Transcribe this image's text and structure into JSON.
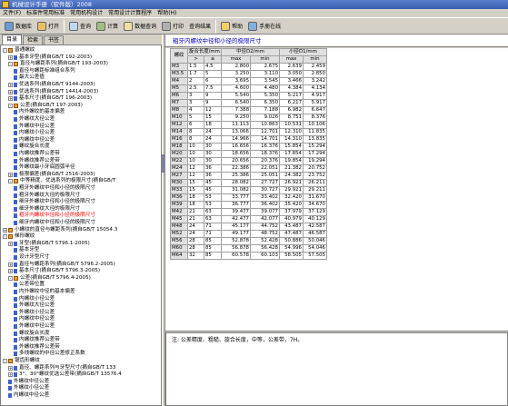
{
  "window": {
    "title": "机械设计手册（软件版）2008"
  },
  "menu": [
    "文件(F)",
    "标准件常用标准",
    "常用机构设计",
    "常用设计计算程序",
    "帮助(H)"
  ],
  "toolbar": {
    "items": [
      "数据库",
      "打开",
      "查询",
      "计算",
      "数据查询",
      "打印",
      "帮助",
      "手册在线"
    ],
    "status_text": "查询结果"
  },
  "tabs": [
    "目录",
    "检索",
    "书签"
  ],
  "tree": [
    {
      "label": "普通螺纹",
      "level": 1,
      "toggle": "-",
      "kind": "folder"
    },
    {
      "label": "基本牙型(摘自GB/T 192-2003)",
      "level": 2,
      "toggle": "+",
      "kind": "doc"
    },
    {
      "label": "直径与螺距系列(摘自GB/T 193-2003)",
      "level": 2,
      "toggle": "-",
      "kind": "folder"
    },
    {
      "label": "直径与螺距标准组合系列",
      "level": 3,
      "toggle": "",
      "kind": "doc"
    },
    {
      "label": "最大公差值",
      "level": 3,
      "toggle": "",
      "kind": "doc"
    },
    {
      "label": "优选系列(摘自GB/T 9144-2003)",
      "level": 2,
      "toggle": "+",
      "kind": "doc"
    },
    {
      "label": "优选系列(摘自GB/T 14414-2003)",
      "level": 2,
      "toggle": "+",
      "kind": "doc"
    },
    {
      "label": "基本尺寸(摘自GB/T 196-2003)",
      "level": 2,
      "toggle": "+",
      "kind": "doc"
    },
    {
      "label": "公差(摘自GB/T 197-2003)",
      "level": 2,
      "toggle": "-",
      "kind": "folder"
    },
    {
      "label": "内外螺纹的基本偏差",
      "level": 3,
      "toggle": "",
      "kind": "doc"
    },
    {
      "label": "外螺纹大径公差",
      "level": 3,
      "toggle": "",
      "kind": "doc"
    },
    {
      "label": "外螺纹中径公差",
      "level": 3,
      "toggle": "",
      "kind": "doc"
    },
    {
      "label": "内螺纹小径公差",
      "level": 3,
      "toggle": "",
      "kind": "doc"
    },
    {
      "label": "内螺纹中径公差",
      "level": 3,
      "toggle": "",
      "kind": "doc"
    },
    {
      "label": "螺纹旋合长度",
      "level": 3,
      "toggle": "",
      "kind": "doc"
    },
    {
      "label": "内螺纹推荐公差带",
      "level": 3,
      "toggle": "",
      "kind": "doc"
    },
    {
      "label": "外螺纹推荐公差带",
      "level": 3,
      "toggle": "",
      "kind": "doc"
    },
    {
      "label": "外螺纹最小牙底圆弧半径",
      "level": 3,
      "toggle": "",
      "kind": "doc"
    },
    {
      "label": "极限偏差(摘自GB/T 2516-2003)",
      "level": 2,
      "toggle": "+",
      "kind": "doc"
    },
    {
      "label": "中等精度、优选系列的极限尺寸(摘自GB/T",
      "level": 2,
      "toggle": "-",
      "kind": "folder"
    },
    {
      "label": "粗牙外螺纹中径和小径的极限尺寸",
      "level": 3,
      "toggle": "",
      "kind": "doc"
    },
    {
      "label": "粗牙外螺纹大径的极限尺寸",
      "level": 3,
      "toggle": "",
      "kind": "doc"
    },
    {
      "label": "细牙外螺纹中径和小径的极限尺寸",
      "level": 3,
      "toggle": "",
      "kind": "doc"
    },
    {
      "label": "细牙外螺纹大径的极限尺寸",
      "level": 3,
      "toggle": "",
      "kind": "doc"
    },
    {
      "label": "粗牙内螺纹中径和小径的极限尺寸",
      "level": 3,
      "toggle": "",
      "kind": "doc",
      "selected": true
    },
    {
      "label": "细牙内螺纹中径和小径的极限尺寸",
      "level": 3,
      "toggle": "",
      "kind": "doc"
    },
    {
      "label": "小螺纹的直径与螺距系列(摘自GB/T 15054.3",
      "level": 1,
      "toggle": "+",
      "kind": "folder"
    },
    {
      "label": "梯形螺纹",
      "level": 1,
      "toggle": "-",
      "kind": "folder"
    },
    {
      "label": "牙型(摘自GB/T 5796.1-2005)",
      "level": 2,
      "toggle": "+",
      "kind": "doc"
    },
    {
      "label": "基本牙型",
      "level": 3,
      "toggle": "",
      "kind": "doc"
    },
    {
      "label": "设计牙型尺寸",
      "level": 3,
      "toggle": "",
      "kind": "doc"
    },
    {
      "label": "直径与螺距系列(摘自GB/T 5796.2-2005)",
      "level": 2,
      "toggle": "+",
      "kind": "doc"
    },
    {
      "label": "基本尺寸(摘自GB/T 5796.3-2005)",
      "level": 2,
      "toggle": "+",
      "kind": "doc"
    },
    {
      "label": "公差(摘自GB/T 5796.4-2005)",
      "level": 2,
      "toggle": "-",
      "kind": "folder"
    },
    {
      "label": "公差带位置",
      "level": 3,
      "toggle": "",
      "kind": "doc"
    },
    {
      "label": "内外螺纹中径的基本偏差",
      "level": 3,
      "toggle": "",
      "kind": "doc"
    },
    {
      "label": "内螺纹小径公差",
      "level": 3,
      "toggle": "",
      "kind": "doc"
    },
    {
      "label": "外螺纹大径公差",
      "level": 3,
      "toggle": "",
      "kind": "doc"
    },
    {
      "label": "外螺纹小径公差",
      "level": 3,
      "toggle": "",
      "kind": "doc"
    },
    {
      "label": "内螺纹中径公差",
      "level": 3,
      "toggle": "",
      "kind": "doc"
    },
    {
      "label": "外螺纹中径公差",
      "level": 3,
      "toggle": "",
      "kind": "doc"
    },
    {
      "label": "螺纹旋合长度",
      "level": 3,
      "toggle": "",
      "kind": "doc"
    },
    {
      "label": "内螺纹推荐公差带",
      "level": 3,
      "toggle": "",
      "kind": "doc"
    },
    {
      "label": "外螺纹推荐公差带",
      "level": 3,
      "toggle": "",
      "kind": "doc"
    },
    {
      "label": "多线螺纹的中径公差修正系数",
      "level": 3,
      "toggle": "",
      "kind": "doc"
    },
    {
      "label": "锯齿形螺纹",
      "level": 1,
      "toggle": "-",
      "kind": "folder"
    },
    {
      "label": "直径、螺距系列与牙型尺寸(摘自GB/T 133",
      "level": 2,
      "toggle": "+",
      "kind": "doc"
    },
    {
      "label": "3°、30°螺纹优选公差带(摘自GB/T 13576.4",
      "level": 2,
      "toggle": "+",
      "kind": "doc"
    },
    {
      "label": "外螺纹中径公差",
      "level": 2,
      "toggle": "",
      "kind": "doc"
    },
    {
      "label": "外螺纹小径公差",
      "level": 2,
      "toggle": "",
      "kind": "doc"
    },
    {
      "label": "内螺纹中径公差",
      "level": 2,
      "toggle": "",
      "kind": "doc"
    }
  ],
  "panel": {
    "heading": "粗牙内螺纹中径和小径的极限尺寸"
  },
  "table": {
    "header1": [
      "螺纹",
      "旋合长度/mm",
      "中径D2/mm",
      "小径D1/mm"
    ],
    "header2": [
      ">",
      "≤",
      "max",
      "min",
      "max",
      "min"
    ],
    "rows": [
      [
        "M3",
        "1.5",
        "4.5",
        "2.800",
        "2.675",
        "2.639",
        "2.459"
      ],
      [
        "M3.5",
        "1.7",
        "5",
        "3.250",
        "3.110",
        "3.050",
        "2.850"
      ],
      [
        "M4",
        "2",
        "6",
        "3.695",
        "3.545",
        "3.466",
        "3.242"
      ],
      [
        "M5",
        "2.5",
        "7.5",
        "4.600",
        "4.480",
        "4.384",
        "4.134"
      ],
      [
        "M6",
        "3",
        "9",
        "5.540",
        "5.350",
        "5.217",
        "4.917"
      ],
      [
        "M7",
        "3",
        "9",
        "6.540",
        "6.350",
        "6.217",
        "5.917"
      ],
      [
        "M8",
        "4",
        "12",
        "7.388",
        "7.188",
        "6.982",
        "6.647"
      ],
      [
        "M10",
        "5",
        "15",
        "9.250",
        "9.026",
        "8.751",
        "8.376"
      ],
      [
        "M12",
        "6",
        "18",
        "11.113",
        "10.863",
        "10.531",
        "10.106"
      ],
      [
        "M14",
        "8",
        "24",
        "13.066",
        "12.701",
        "12.310",
        "11.835"
      ],
      [
        "M16",
        "8",
        "24",
        "14.966",
        "14.701",
        "14.310",
        "13.835"
      ],
      [
        "M18",
        "10",
        "30",
        "16.656",
        "16.376",
        "15.854",
        "15.294"
      ],
      [
        "M20",
        "10",
        "30",
        "18.656",
        "18.376",
        "17.854",
        "17.294"
      ],
      [
        "M22",
        "10",
        "30",
        "20.656",
        "20.376",
        "19.854",
        "19.294"
      ],
      [
        "M24",
        "12",
        "36",
        "22.386",
        "22.051",
        "21.382",
        "20.752"
      ],
      [
        "M27",
        "12",
        "36",
        "25.386",
        "25.051",
        "24.382",
        "23.752"
      ],
      [
        "M30",
        "15",
        "45",
        "28.082",
        "27.727",
        "26.921",
        "26.211"
      ],
      [
        "M33",
        "15",
        "45",
        "31.082",
        "30.727",
        "29.921",
        "29.211"
      ],
      [
        "M36",
        "18",
        "53",
        "33.777",
        "33.402",
        "32.420",
        "31.670"
      ],
      [
        "M39",
        "18",
        "53",
        "36.777",
        "36.402",
        "35.420",
        "34.670"
      ],
      [
        "M42",
        "21",
        "63",
        "39.477",
        "39.077",
        "37.979",
        "37.129"
      ],
      [
        "M45",
        "21",
        "63",
        "42.477",
        "42.077",
        "40.979",
        "40.129"
      ],
      [
        "M48",
        "24",
        "71",
        "45.177",
        "44.752",
        "43.487",
        "42.587"
      ],
      [
        "M52",
        "24",
        "71",
        "49.177",
        "48.752",
        "47.487",
        "46.587"
      ],
      [
        "M56",
        "28",
        "85",
        "52.878",
        "52.428",
        "50.886",
        "50.046"
      ],
      [
        "M60",
        "28",
        "85",
        "56.878",
        "56.428",
        "54.996",
        "54.046"
      ],
      [
        "M64",
        "32",
        "85",
        "60.578",
        "60.103",
        "58.505",
        "57.505"
      ]
    ]
  },
  "note": {
    "text": "注: 公差精度、粗糙、旋合长度，中等，公差带，7H。"
  }
}
